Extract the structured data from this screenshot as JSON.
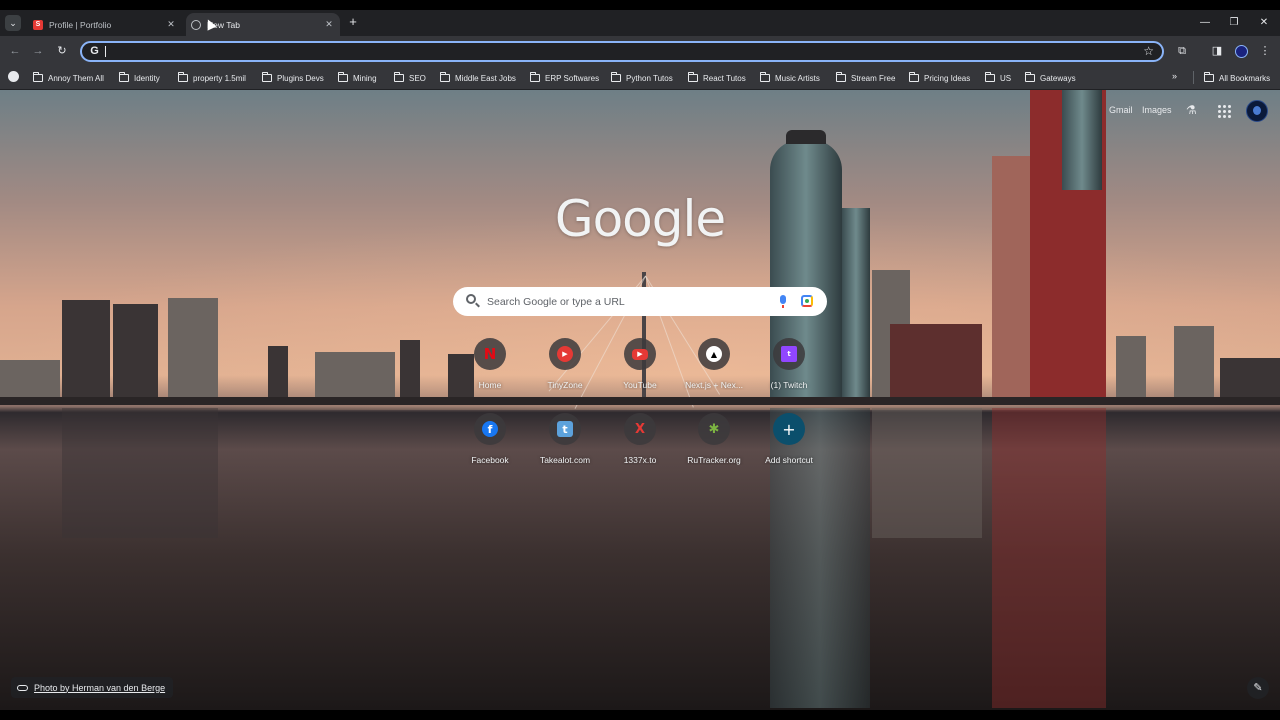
{
  "browser": {
    "tabs": [
      {
        "title": "Profile | Portfolio",
        "favicon": "s-logo-icon"
      },
      {
        "title": "New Tab",
        "favicon": "globe-icon"
      }
    ],
    "toolbar": {
      "address_value": "",
      "omnibox_icon": "G"
    },
    "bookmarks": [
      "Annoy Them All",
      "Identity",
      "property 1.5mil",
      "Plugins Devs",
      "Mining",
      "SEO",
      "Middle East Jobs",
      "ERP Softwares",
      "Python Tutos",
      "React Tutos",
      "Music Artists",
      "Stream Free",
      "Pricing Ideas",
      "US",
      "Gateways"
    ],
    "all_bookmarks_label": "All Bookmarks"
  },
  "ntp": {
    "links": {
      "gmail": "Gmail",
      "images": "Images"
    },
    "logo": "Google",
    "search_placeholder": "Search Google or type a URL",
    "shortcuts": [
      {
        "label": "Home",
        "icon": "netflix-icon",
        "glyph": "N"
      },
      {
        "label": "TinyZone",
        "icon": "tinyzone-icon",
        "glyph": "▶"
      },
      {
        "label": "YouTube",
        "icon": "youtube-icon",
        "glyph": "▶"
      },
      {
        "label": "Next.js + Nex...",
        "icon": "vercel-icon",
        "glyph": "▲"
      },
      {
        "label": "(1) Twitch",
        "icon": "twitch-icon",
        "glyph": "t"
      },
      {
        "label": "Facebook",
        "icon": "facebook-icon",
        "glyph": "f"
      },
      {
        "label": "Takealot.com",
        "icon": "takealot-icon",
        "glyph": "t"
      },
      {
        "label": "1337x.to",
        "icon": "1337x-icon",
        "glyph": "X"
      },
      {
        "label": "RuTracker.org",
        "icon": "rutracker-icon",
        "glyph": "✱"
      },
      {
        "label": "Add shortcut",
        "icon": "plus-icon",
        "glyph": "+"
      }
    ],
    "photo_credit": "Photo by Herman van den Berge"
  },
  "colors": {
    "accent": "#8ab4f8",
    "tab_bar": "#202124",
    "toolbar": "#35363a"
  }
}
